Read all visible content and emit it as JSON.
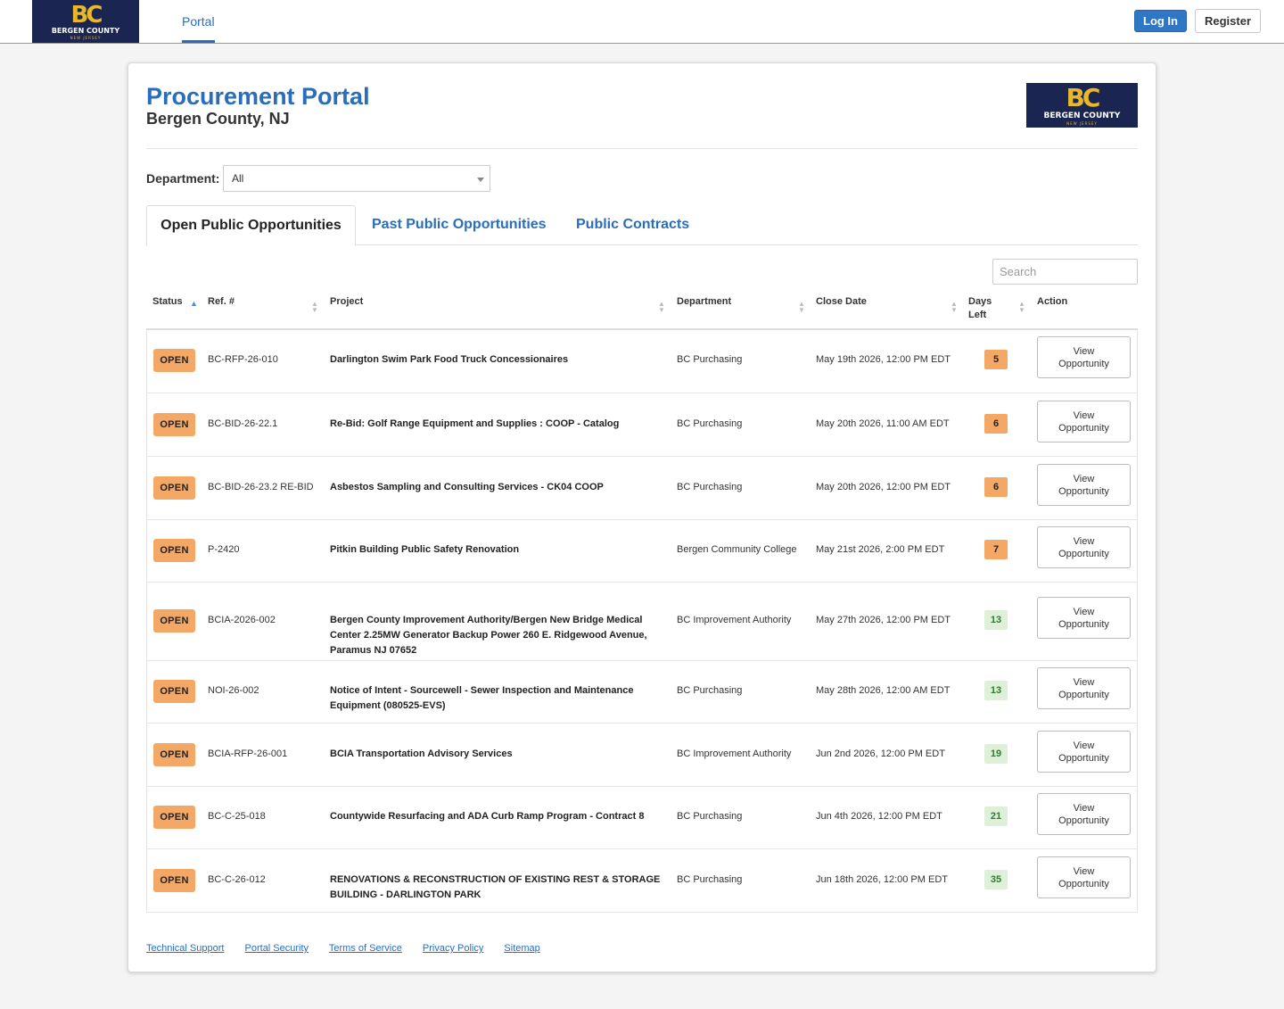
{
  "header": {
    "logo": {
      "mark": "BC",
      "name": "BERGEN COUNTY",
      "state": "NEW JERSEY"
    },
    "nav_portal": "Portal",
    "login_label": "Log In",
    "register_label": "Register"
  },
  "page": {
    "title": "Procurement Portal",
    "subtitle": "Bergen County, NJ"
  },
  "filter": {
    "department_label": "Department:",
    "department_value": "All"
  },
  "tabs": [
    {
      "label": "Open Public Opportunities",
      "active": true
    },
    {
      "label": "Past Public Opportunities",
      "active": false
    },
    {
      "label": "Public Contracts",
      "active": false
    }
  ],
  "search": {
    "placeholder": "Search"
  },
  "table": {
    "columns": {
      "status": "Status",
      "ref": "Ref. #",
      "project": "Project",
      "department": "Department",
      "close_date": "Close Date",
      "days_left": "Days Left",
      "action": "Action"
    },
    "rows": [
      {
        "status": "OPEN",
        "ref": "BC-RFP-26-010",
        "project": "Darlington Swim Park Food Truck Concessionaires",
        "department": "BC Purchasing",
        "close_date": "May 19th 2026, 12:00 PM EDT",
        "days_left": "5",
        "action": "View Opportunity"
      },
      {
        "status": "OPEN",
        "ref": "BC-BID-26-22.1",
        "project": "Re-Bid: Golf Range Equipment and Supplies : COOP - Catalog",
        "department": "BC Purchasing",
        "close_date": "May 20th 2026, 11:00 AM EDT",
        "days_left": "6",
        "action": "View Opportunity"
      },
      {
        "status": "OPEN",
        "ref": "BC-BID-26-23.2 RE-BID",
        "project": "Asbestos Sampling and Consulting Services - CK04 COOP",
        "department": "BC Purchasing",
        "close_date": "May 20th 2026, 12:00 PM EDT",
        "days_left": "6",
        "action": "View Opportunity"
      },
      {
        "status": "OPEN",
        "ref": "P-2420",
        "project": "Pitkin Building Public Safety Renovation",
        "department": "Bergen Community College",
        "close_date": "May 21st 2026, 2:00 PM EDT",
        "days_left": "7",
        "action": "View Opportunity"
      },
      {
        "status": "OPEN",
        "ref": "BCIA-2026-002",
        "project": "Bergen County Improvement Authority/Bergen New Bridge Medical Center 2.25MW Generator Backup Power 260 E. Ridgewood Avenue, Paramus NJ 07652",
        "department": "BC Improvement Authority",
        "close_date": "May 27th 2026, 12:00 PM EDT",
        "days_left": "13",
        "action": "View Opportunity"
      },
      {
        "status": "OPEN",
        "ref": "NOI-26-002",
        "project": "Notice of Intent - Sourcewell - Sewer Inspection and Maintenance Equipment (080525-EVS)",
        "department": "BC Purchasing",
        "close_date": "May 28th 2026, 12:00 AM EDT",
        "days_left": "13",
        "action": "View Opportunity"
      },
      {
        "status": "OPEN",
        "ref": "BCIA-RFP-26-001",
        "project": "BCIA Transportation Advisory Services",
        "department": "BC Improvement Authority",
        "close_date": "Jun 2nd 2026, 12:00 PM EDT",
        "days_left": "19",
        "action": "View Opportunity"
      },
      {
        "status": "OPEN",
        "ref": "BC-C-25-018",
        "project": "Countywide Resurfacing and ADA Curb Ramp Program - Contract 8",
        "department": "BC Purchasing",
        "close_date": "Jun 4th 2026, 12:00 PM EDT",
        "days_left": "21",
        "action": "View Opportunity"
      },
      {
        "status": "OPEN",
        "ref": "BC-C-26-012",
        "project": "RENOVATIONS & RECONSTRUCTION OF EXISTING REST & STORAGE BUILDING - DARLINGTON PARK",
        "department": "BC Purchasing",
        "close_date": "Jun 18th 2026, 12:00 PM EDT",
        "days_left": "35",
        "action": "View Opportunity"
      }
    ]
  },
  "footer": {
    "links": [
      "Technical Support",
      "Portal Security",
      "Terms of Service",
      "Privacy Policy",
      "Sitemap"
    ]
  }
}
